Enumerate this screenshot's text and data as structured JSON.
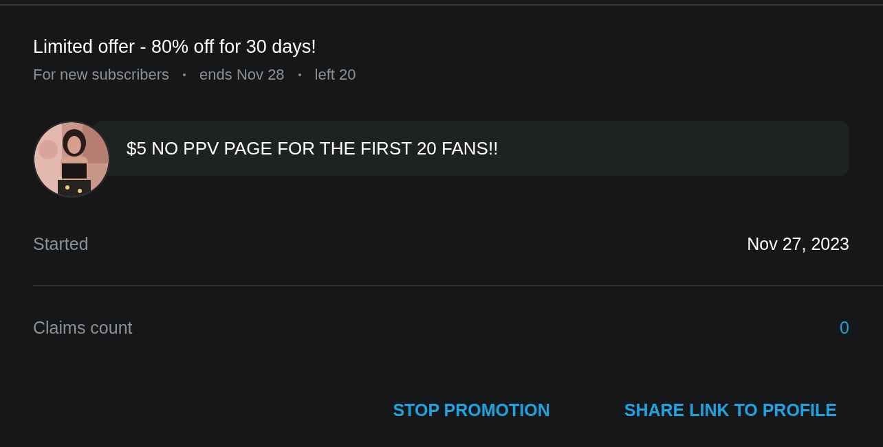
{
  "offer": {
    "title": "Limited offer - 80% off for 30 days!",
    "meta": [
      "For new subscribers",
      "ends Nov 28",
      "left 20"
    ]
  },
  "message": {
    "text": "$5 NO PPV PAGE FOR THE FIRST 20 FANS!!"
  },
  "details": [
    {
      "label": "Started",
      "value": "Nov 27, 2023",
      "kind": "plain"
    },
    {
      "label": "Claims count",
      "value": "0",
      "kind": "link"
    }
  ],
  "actions": [
    "STOP PROMOTION",
    "SHARE LINK TO PROFILE"
  ]
}
